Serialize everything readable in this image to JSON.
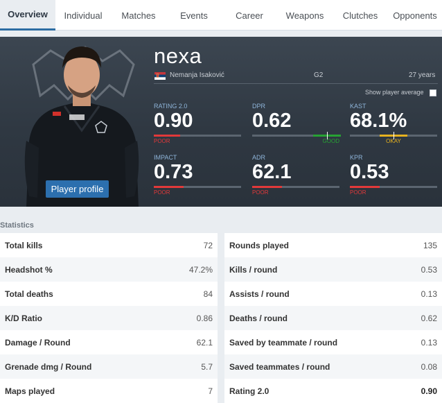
{
  "tabs": [
    {
      "label": "Overview",
      "active": true
    },
    {
      "label": "Individual"
    },
    {
      "label": "Matches"
    },
    {
      "label": "Events"
    },
    {
      "label": "Career"
    },
    {
      "label": "Weapons"
    },
    {
      "label": "Clutches"
    },
    {
      "label": "Opponents"
    }
  ],
  "player": {
    "nick": "nexa",
    "real_name": "Nemanja Isaković",
    "team": "G2",
    "age": "27 years",
    "country_flag": "serbia-flag",
    "profile_button": "Player profile"
  },
  "show_average_label": "Show player average",
  "summary": {
    "rating": {
      "label": "RATING 2.0",
      "value": "0.90",
      "grade": "POOR",
      "grade_color": "#e1393a",
      "level": 0.3
    },
    "dpr": {
      "label": "DPR",
      "value": "0.62",
      "grade": "GOOD",
      "grade_color": "#27a233",
      "level": 0.86
    },
    "kast": {
      "label": "KAST",
      "value": "68.1%",
      "grade": "OKAY",
      "grade_color": "#e7b21f",
      "level": 0.5
    },
    "impact": {
      "label": "IMPACT",
      "value": "0.73",
      "grade": "POOR",
      "grade_color": "#e1393a",
      "level": 0.34
    },
    "adr": {
      "label": "ADR",
      "value": "62.1",
      "grade": "POOR",
      "grade_color": "#e1393a",
      "level": 0.34
    },
    "kpr": {
      "label": "KPR",
      "value": "0.53",
      "grade": "POOR",
      "grade_color": "#e1393a",
      "level": 0.34
    }
  },
  "statistics": {
    "title": "Statistics",
    "left": [
      {
        "label": "Total kills",
        "value": "72"
      },
      {
        "label": "Headshot %",
        "value": "47.2%"
      },
      {
        "label": "Total deaths",
        "value": "84"
      },
      {
        "label": "K/D Ratio",
        "value": "0.86"
      },
      {
        "label": "Damage / Round",
        "value": "62.1"
      },
      {
        "label": "Grenade dmg / Round",
        "value": "5.7"
      },
      {
        "label": "Maps played",
        "value": "7"
      }
    ],
    "right": [
      {
        "label": "Rounds played",
        "value": "135"
      },
      {
        "label": "Kills / round",
        "value": "0.53"
      },
      {
        "label": "Assists / round",
        "value": "0.13"
      },
      {
        "label": "Deaths / round",
        "value": "0.62"
      },
      {
        "label": "Saved by teammate / round",
        "value": "0.13"
      },
      {
        "label": "Saved teammates / round",
        "value": "0.08"
      },
      {
        "label": "Rating 2.0",
        "value": "0.90"
      }
    ]
  },
  "colors": {
    "accent": "#2d6da3",
    "hero_bg": "#333c46",
    "button": "#2c6fae"
  }
}
